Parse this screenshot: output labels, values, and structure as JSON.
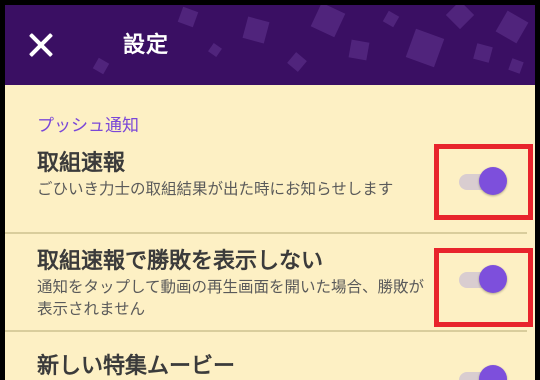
{
  "header": {
    "title": "設定",
    "close_icon": "close-icon"
  },
  "section": {
    "label": "プッシュ通知"
  },
  "settings": [
    {
      "title": "取組速報",
      "description": "ごひいき力士の取組結果が出た時にお知らせします",
      "enabled": true
    },
    {
      "title": "取組速報で勝敗を表示しない",
      "description": "通知をタップして動画の再生画面を開いた場合、勝敗が表示されません",
      "enabled": true
    },
    {
      "title": "新しい特集ムービー",
      "enabled": true
    }
  ],
  "colors": {
    "header_bg": "#3a0f63",
    "page_bg": "#fdf0c4",
    "accent": "#7d4fdc",
    "highlight": "#e8242c"
  }
}
